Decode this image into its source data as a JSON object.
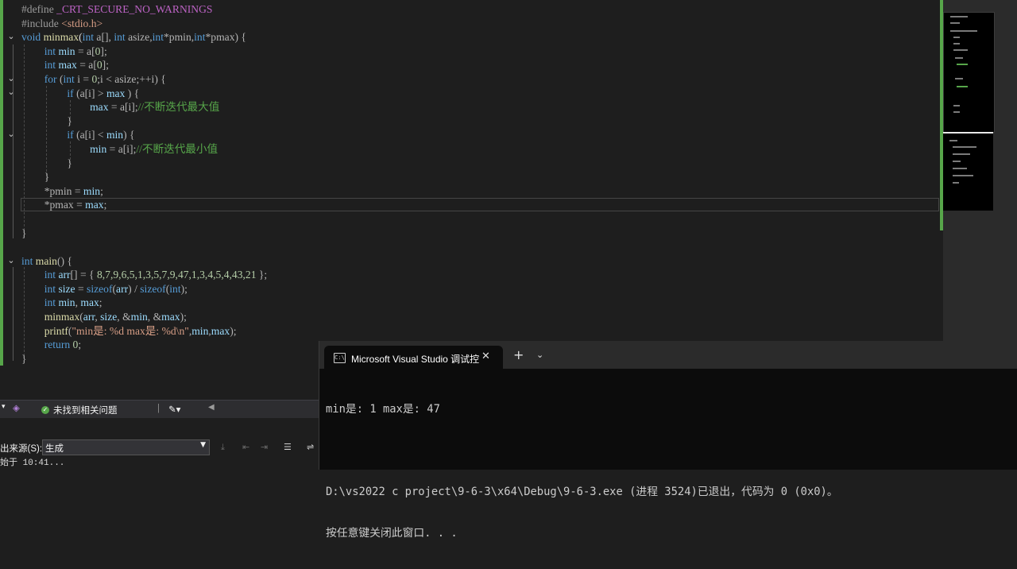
{
  "editor": {
    "lines": [
      [
        [
          "pp",
          "#define "
        ],
        [
          "mac",
          "_CRT_SECURE_NO_WARNINGS"
        ]
      ],
      [
        [
          "pp",
          "#include "
        ],
        [
          "str",
          "<stdio.h>"
        ]
      ],
      [
        [
          "kw",
          "void "
        ],
        [
          "fn",
          "minmax"
        ],
        [
          "plain",
          "("
        ],
        [
          "kw",
          "int "
        ],
        [
          "op",
          "a[], "
        ],
        [
          "kw",
          "int "
        ],
        [
          "op",
          "asize,"
        ],
        [
          "kw",
          "int"
        ],
        [
          "op",
          "*pmin,"
        ],
        [
          "kw",
          "int"
        ],
        [
          "op",
          "*pmax) {"
        ]
      ],
      [
        [
          "plain",
          "    "
        ],
        [
          "kw",
          "int "
        ],
        [
          "var",
          "min"
        ],
        [
          "op",
          " = a["
        ],
        [
          "num",
          "0"
        ],
        [
          "op",
          "];"
        ]
      ],
      [
        [
          "plain",
          "    "
        ],
        [
          "kw",
          "int "
        ],
        [
          "var",
          "max"
        ],
        [
          "op",
          " = a["
        ],
        [
          "num",
          "0"
        ],
        [
          "op",
          "];"
        ]
      ],
      [
        [
          "plain",
          "    "
        ],
        [
          "kw",
          "for "
        ],
        [
          "op",
          "("
        ],
        [
          "kw",
          "int "
        ],
        [
          "op",
          "i = "
        ],
        [
          "num",
          "0"
        ],
        [
          "op",
          ";i < asize;++i) {"
        ]
      ],
      [
        [
          "plain",
          "        "
        ],
        [
          "kw",
          "if "
        ],
        [
          "op",
          "(a[i] > "
        ],
        [
          "var",
          "max"
        ],
        [
          "op",
          " ) {"
        ]
      ],
      [
        [
          "plain",
          "            "
        ],
        [
          "var",
          "max"
        ],
        [
          "op",
          " = a[i];"
        ],
        [
          "cm",
          "//不断迭代最大值"
        ]
      ],
      [
        [
          "plain",
          "        "
        ],
        [
          "op",
          "}"
        ]
      ],
      [
        [
          "plain",
          "        "
        ],
        [
          "kw",
          "if "
        ],
        [
          "op",
          "(a[i] < "
        ],
        [
          "var",
          "min"
        ],
        [
          "op",
          ") {"
        ]
      ],
      [
        [
          "plain",
          "            "
        ],
        [
          "var",
          "min"
        ],
        [
          "op",
          " = a[i];"
        ],
        [
          "cm",
          "//不断迭代最小值"
        ]
      ],
      [
        [
          "plain",
          "        "
        ],
        [
          "op",
          "}"
        ]
      ],
      [
        [
          "plain",
          "    "
        ],
        [
          "op",
          "}"
        ]
      ],
      [
        [
          "plain",
          "    "
        ],
        [
          "op",
          "*pmin = "
        ],
        [
          "var",
          "min"
        ],
        [
          "op",
          ";"
        ]
      ],
      [
        [
          "plain",
          "    "
        ],
        [
          "op",
          "*pmax = "
        ],
        [
          "var",
          "max"
        ],
        [
          "op",
          ";"
        ]
      ],
      [
        [
          "plain",
          ""
        ]
      ],
      [
        [
          "op",
          "}"
        ]
      ],
      [
        [
          "plain",
          ""
        ]
      ],
      [
        [
          "kw",
          "int "
        ],
        [
          "fn",
          "main"
        ],
        [
          "op",
          "() {"
        ]
      ],
      [
        [
          "plain",
          "    "
        ],
        [
          "kw",
          "int "
        ],
        [
          "var",
          "arr"
        ],
        [
          "op",
          "[] = { "
        ],
        [
          "num",
          "8,7,9,6,5,1,3,5,7,9,47,1,3,4,5,4,43,21"
        ],
        [
          "op",
          " };"
        ]
      ],
      [
        [
          "plain",
          "    "
        ],
        [
          "kw",
          "int "
        ],
        [
          "var",
          "size"
        ],
        [
          "op",
          " = "
        ],
        [
          "kw",
          "sizeof"
        ],
        [
          "op",
          "("
        ],
        [
          "var",
          "arr"
        ],
        [
          "op",
          ") / "
        ],
        [
          "kw",
          "sizeof"
        ],
        [
          "op",
          "("
        ],
        [
          "kw",
          "int"
        ],
        [
          "op",
          ");"
        ]
      ],
      [
        [
          "plain",
          "    "
        ],
        [
          "kw",
          "int "
        ],
        [
          "var",
          "min"
        ],
        [
          "op",
          ", "
        ],
        [
          "var",
          "max"
        ],
        [
          "op",
          ";"
        ]
      ],
      [
        [
          "plain",
          "    "
        ],
        [
          "fn",
          "minmax"
        ],
        [
          "op",
          "("
        ],
        [
          "var",
          "arr"
        ],
        [
          "op",
          ", "
        ],
        [
          "var",
          "size"
        ],
        [
          "op",
          ", &"
        ],
        [
          "var",
          "min"
        ],
        [
          "op",
          ", &"
        ],
        [
          "var",
          "max"
        ],
        [
          "op",
          ");"
        ]
      ],
      [
        [
          "plain",
          "    "
        ],
        [
          "fn",
          "printf"
        ],
        [
          "op",
          "("
        ],
        [
          "str",
          "\"min是: %d max是: %d\\n\""
        ],
        [
          "op",
          ","
        ],
        [
          "var",
          "min"
        ],
        [
          "op",
          ","
        ],
        [
          "var",
          "max"
        ],
        [
          "op",
          ");"
        ]
      ],
      [
        [
          "plain",
          "    "
        ],
        [
          "kw",
          "return "
        ],
        [
          "num",
          "0"
        ],
        [
          "op",
          ";"
        ]
      ],
      [
        [
          "op",
          "}"
        ]
      ]
    ]
  },
  "status": {
    "issues_text": "未找到相关问题"
  },
  "output": {
    "source_label": "出来源(S):",
    "source_value": "生成",
    "first_line": "始于 10:41..."
  },
  "terminal": {
    "tab_title": "Microsoft Visual Studio 调试控",
    "tab_icon": "console-icon",
    "lines": [
      "min是: 1 max是: 47",
      "",
      "D:\\vs2022 c project\\9-6-3\\x64\\Debug\\9-6-3.exe (进程 3524)已退出，代码为 0 (0x0)。",
      "按任意键关闭此窗口. . ."
    ]
  },
  "colors": {
    "editor_bg": "#1e1e1e",
    "keyword": "#569cd6",
    "comment": "#57a64a",
    "change_bar": "#57a64a",
    "terminal_bg": "#0c0c0c"
  }
}
